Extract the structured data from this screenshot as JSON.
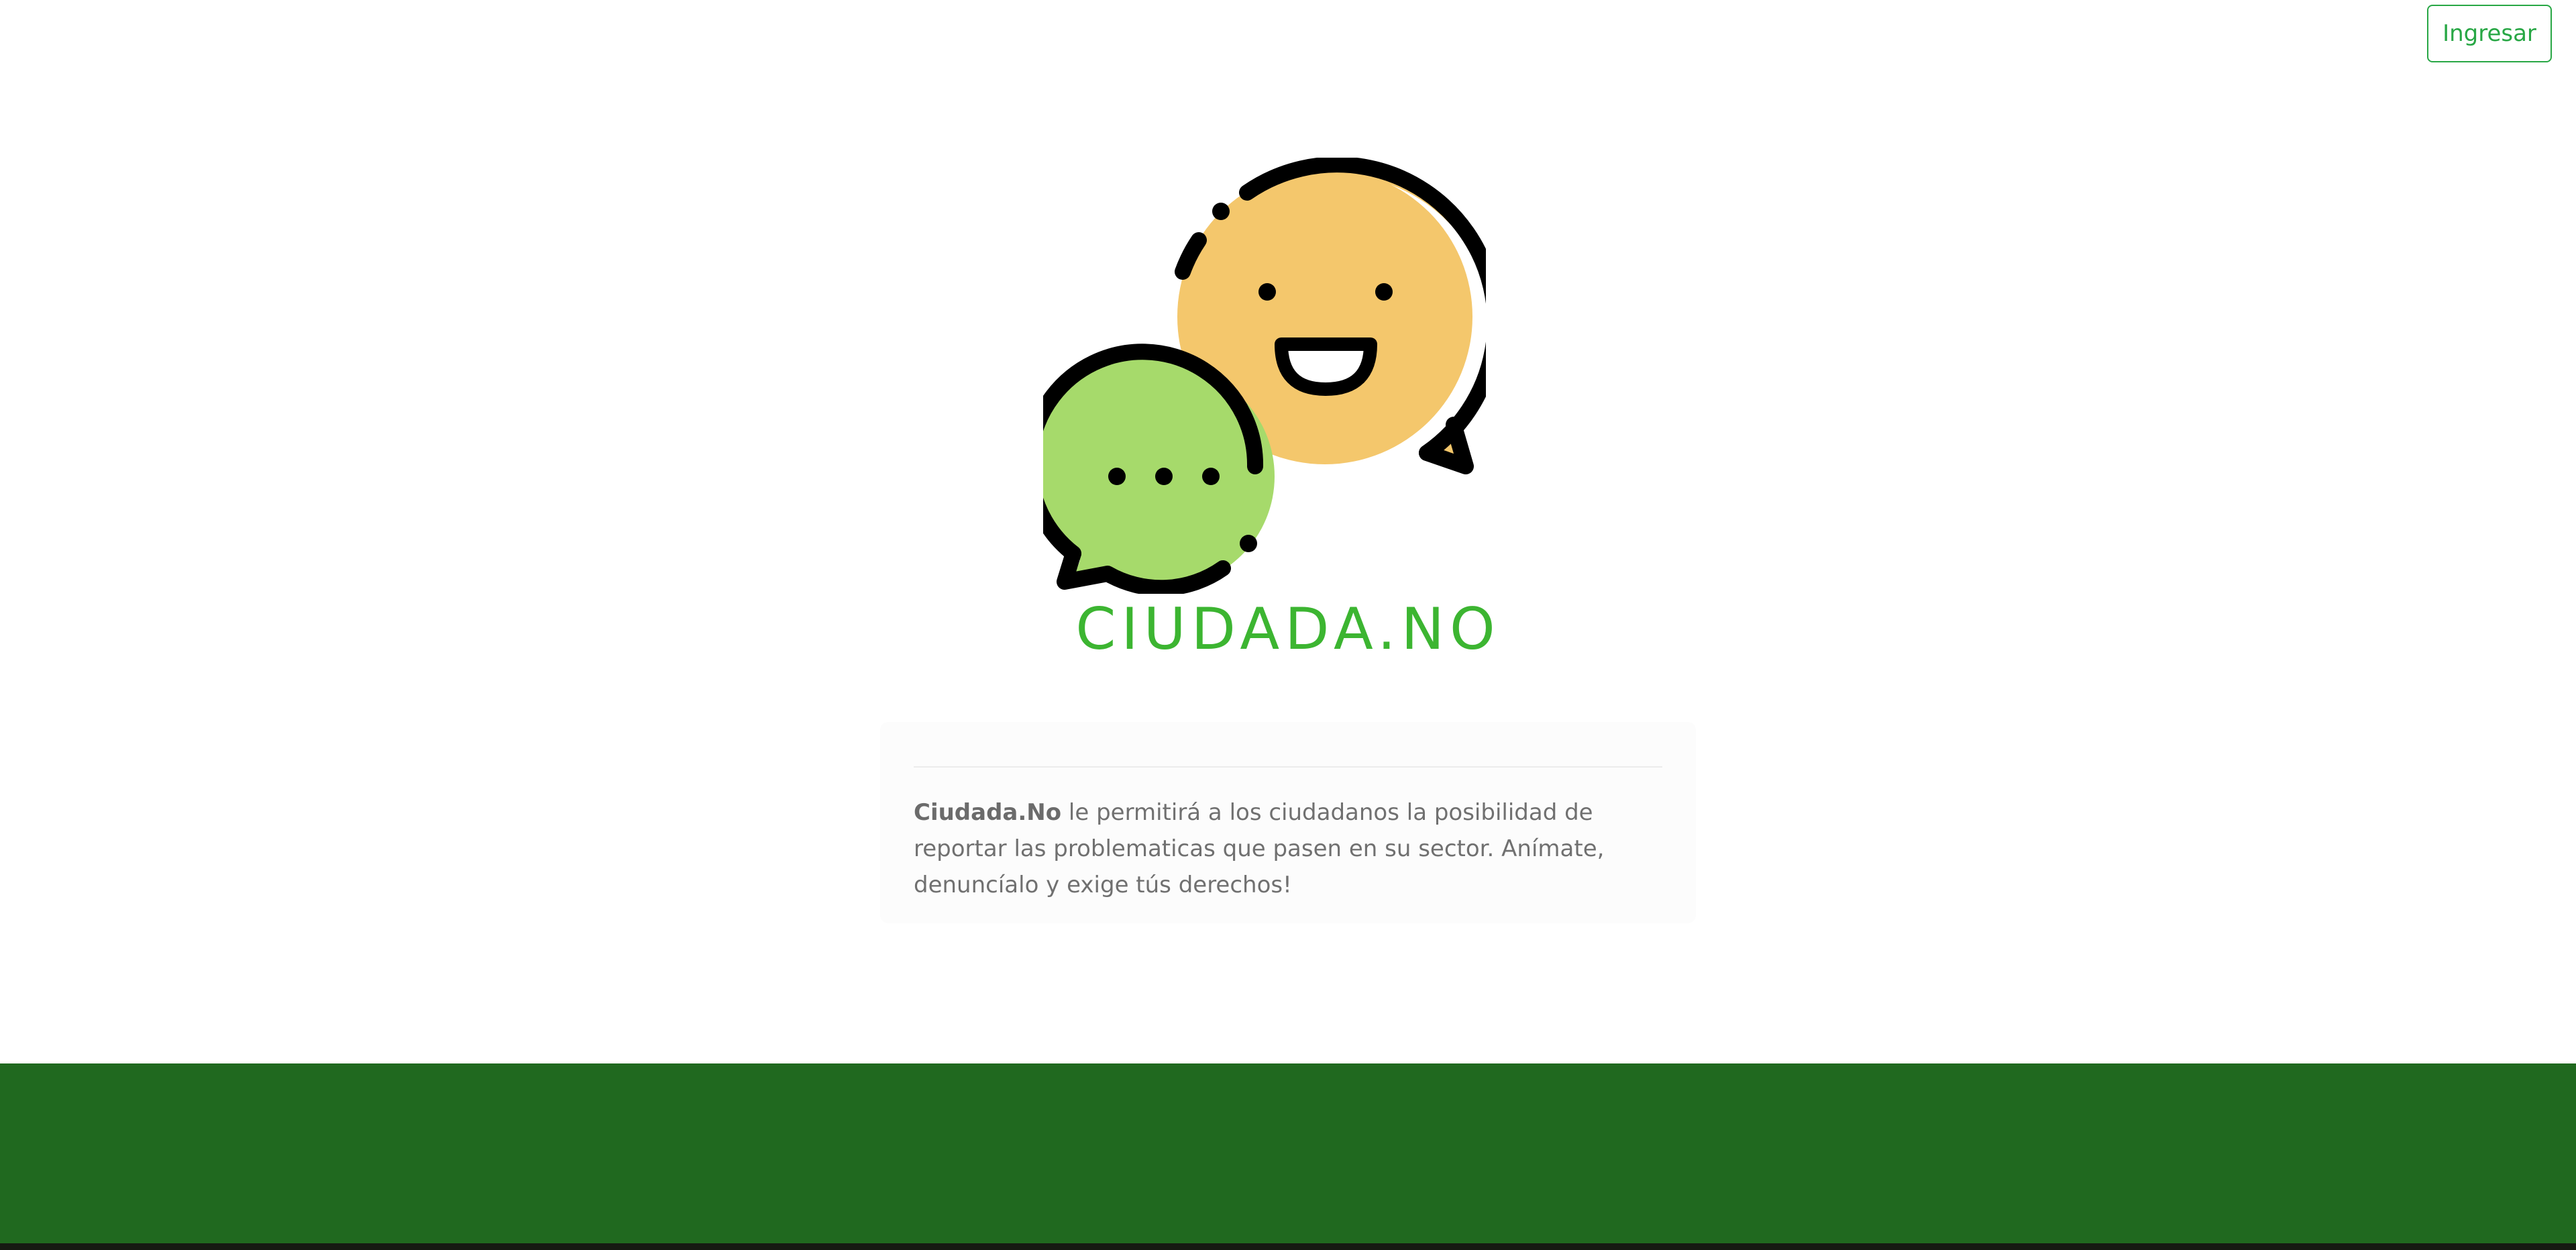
{
  "header": {
    "login_label": "Ingresar"
  },
  "hero": {
    "brand_title": "CIUDADA.NO",
    "logo_icon": "chat-bubbles-icon"
  },
  "description": {
    "brand_name": "Ciudada.No",
    "body": " le permitirá a los ciudadanos la posibilidad de reportar las problematicas que pasen en su sector. Anímate, denuncíalo y exige tús derechos!"
  },
  "colors": {
    "brand_green": "#3cb531",
    "button_green": "#28a745",
    "footer_green": "#20691f",
    "bubble_yellow": "#f4c76c",
    "bubble_green": "#a6da6b"
  }
}
